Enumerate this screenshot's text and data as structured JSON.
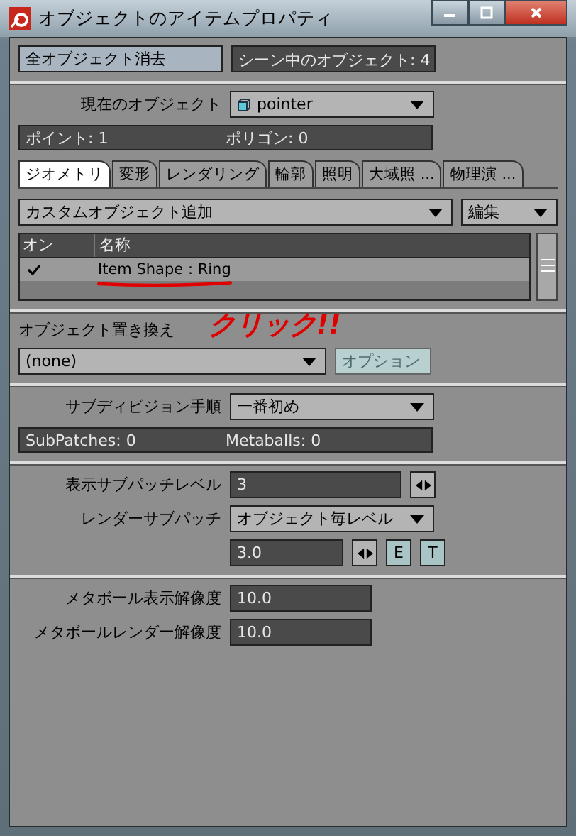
{
  "window": {
    "title": "オブジェクトのアイテムプロパティ"
  },
  "top": {
    "clear_button": "全オブジェクト消去",
    "scene_count": "シーン中のオブジェクト: 4"
  },
  "current_object": {
    "label": "現在のオブジェクト",
    "value": "pointer"
  },
  "object_info": [
    "ポイント: 1",
    "ポリゴン: 0"
  ],
  "tabs": [
    {
      "label": "ジオメトリ",
      "selected": true
    },
    {
      "label": "変形",
      "selected": false
    },
    {
      "label": "レンダリング",
      "selected": false
    },
    {
      "label": "輪郭",
      "selected": false
    },
    {
      "label": "照明",
      "selected": false
    },
    {
      "label": "大域照 ...",
      "selected": false
    },
    {
      "label": "物理演 ...",
      "selected": false
    }
  ],
  "custom_object": {
    "add_dropdown": "カスタムオブジェクト追加",
    "edit_dropdown": "編集"
  },
  "table": {
    "columns": [
      "オン",
      "名称"
    ],
    "rows": [
      {
        "checked": true,
        "name": "Item Shape : Ring"
      }
    ]
  },
  "annotation": {
    "text": "クリック!!",
    "color": "#e00000"
  },
  "replace": {
    "label": "オブジェクト置き換え",
    "value": "(none)",
    "options_button": "オプション",
    "options_disabled": true
  },
  "subdivision": {
    "label": "サブディビジョン手順",
    "value": "一番初め"
  },
  "subdivision_info": [
    "SubPatches: 0",
    "Metaballs: 0"
  ],
  "display_subpatch": {
    "label": "表示サブパッチレベル",
    "value": "3"
  },
  "render_subpatch": {
    "label": "レンダーサブパッチ",
    "mode": "オブジェクト毎レベル",
    "value": "3.0",
    "buttons": [
      "E",
      "T"
    ]
  },
  "metaball": [
    {
      "label": "メタボール表示解像度",
      "value": "10.0"
    },
    {
      "label": "メタボールレンダー解像度",
      "value": "10.0"
    }
  ]
}
